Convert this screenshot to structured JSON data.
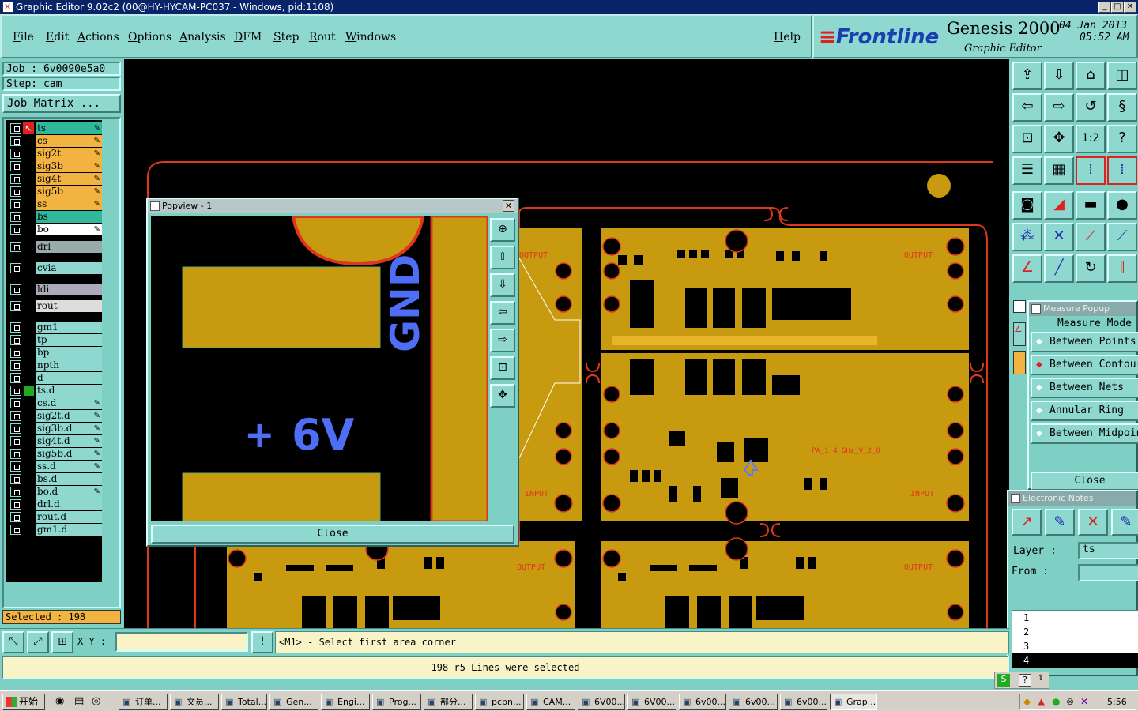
{
  "window": {
    "title": "Graphic Editor 9.02c2 (00@HY-HYCAM-PC037 - Windows, pid:1108)"
  },
  "menu": [
    "File",
    "Edit",
    "Actions",
    "Options",
    "Analysis",
    "DFM",
    "Step",
    "Rout",
    "Windows"
  ],
  "help": "Help",
  "brand": {
    "logo": "Frontline",
    "product": "Genesis 2000",
    "subtitle": "Graphic Editor",
    "date": "04 Jan 2013",
    "time": "05:52 AM"
  },
  "job": {
    "job_label": "Job : 6v0090e5a0",
    "step_label": "Step: cam",
    "matrix_button": "Job Matrix ..."
  },
  "layers": [
    {
      "name": "ts",
      "color": "#2fb89a",
      "pen": "✎"
    },
    {
      "name": "cs",
      "color": "#f2b340",
      "pen": "✎"
    },
    {
      "name": "sig2t",
      "color": "#f2b340",
      "pen": "✎"
    },
    {
      "name": "sig3b",
      "color": "#f2b340",
      "pen": "✎"
    },
    {
      "name": "sig4t",
      "color": "#f2b340",
      "pen": "✎"
    },
    {
      "name": "sig5b",
      "color": "#f2b340",
      "pen": "✎"
    },
    {
      "name": "ss",
      "color": "#f2b340",
      "pen": "✎"
    },
    {
      "name": "bs",
      "color": "#2fb89a",
      "pen": ""
    },
    {
      "name": "bo",
      "color": "#ffffff",
      "pen": "✎"
    },
    {
      "name": "drl",
      "color": "#9aa",
      "pen": ""
    },
    {
      "name": "cvia",
      "color": "#8fd8d0",
      "pen": ""
    },
    {
      "name": "ldi",
      "color": "#aab",
      "pen": ""
    },
    {
      "name": "rout",
      "color": "#ddd",
      "pen": ""
    },
    {
      "name": "gm1",
      "color": "#8fd8d0",
      "pen": ""
    },
    {
      "name": "tp",
      "color": "#8fd8d0",
      "pen": ""
    },
    {
      "name": "bp",
      "color": "#8fd8d0",
      "pen": ""
    },
    {
      "name": "npth",
      "color": "#8fd8d0",
      "pen": ""
    },
    {
      "name": "d",
      "color": "#8fd8d0",
      "pen": ""
    },
    {
      "name": "ts.d",
      "color": "#8fd8d0",
      "pen": ""
    },
    {
      "name": "cs.d",
      "color": "#8fd8d0",
      "pen": "✎"
    },
    {
      "name": "sig2t.d",
      "color": "#8fd8d0",
      "pen": "✎"
    },
    {
      "name": "sig3b.d",
      "color": "#8fd8d0",
      "pen": "✎"
    },
    {
      "name": "sig4t.d",
      "color": "#8fd8d0",
      "pen": "✎"
    },
    {
      "name": "sig5b.d",
      "color": "#8fd8d0",
      "pen": "✎"
    },
    {
      "name": "ss.d",
      "color": "#8fd8d0",
      "pen": "✎"
    },
    {
      "name": "bs.d",
      "color": "#8fd8d0",
      "pen": ""
    },
    {
      "name": "bo.d",
      "color": "#8fd8d0",
      "pen": "✎"
    },
    {
      "name": "drl.d",
      "color": "#8fd8d0",
      "pen": ""
    },
    {
      "name": "rout.d",
      "color": "#8fd8d0",
      "pen": ""
    },
    {
      "name": "gm1.d",
      "color": "#8fd8d0",
      "pen": ""
    }
  ],
  "selected": "Selected : 198",
  "xy_label": "X Y :",
  "prompt": "<M1> - Select first area corner",
  "status": "198 r5 Lines were selected",
  "popview": {
    "title": "Popview - 1",
    "close": "Close",
    "text_gnd": "GND",
    "text_plus": "+",
    "text_6v": "6V"
  },
  "board": {
    "output": "OUTPUT",
    "input": "INPUT",
    "part_label": "PA_1.4 GHz_V_2_0"
  },
  "measure": {
    "title": "Measure Popup",
    "mode_label": "Measure Mode",
    "options": [
      "Between Points",
      "Between Contours",
      "Between Nets",
      "Annular Ring",
      "Between Midpoints"
    ],
    "selected_index": 1,
    "close": "Close"
  },
  "notes": {
    "title": "Electronic Notes",
    "layer_label": "Layer :",
    "layer_value": "ts",
    "from_label": "From :",
    "from_value": "",
    "list": [
      "1",
      "2",
      "3",
      "4"
    ],
    "selected_index": 3
  },
  "taskbar": {
    "start": "开始",
    "items": [
      "订单...",
      "文员...",
      "Total...",
      "Gen...",
      "Engi...",
      "Prog...",
      "部分...",
      "pcbn...",
      "CAM...",
      "6V00...",
      "6V00...",
      "6v00...",
      "6v00...",
      "6v00...",
      "Grap..."
    ],
    "clock": "5:56"
  }
}
